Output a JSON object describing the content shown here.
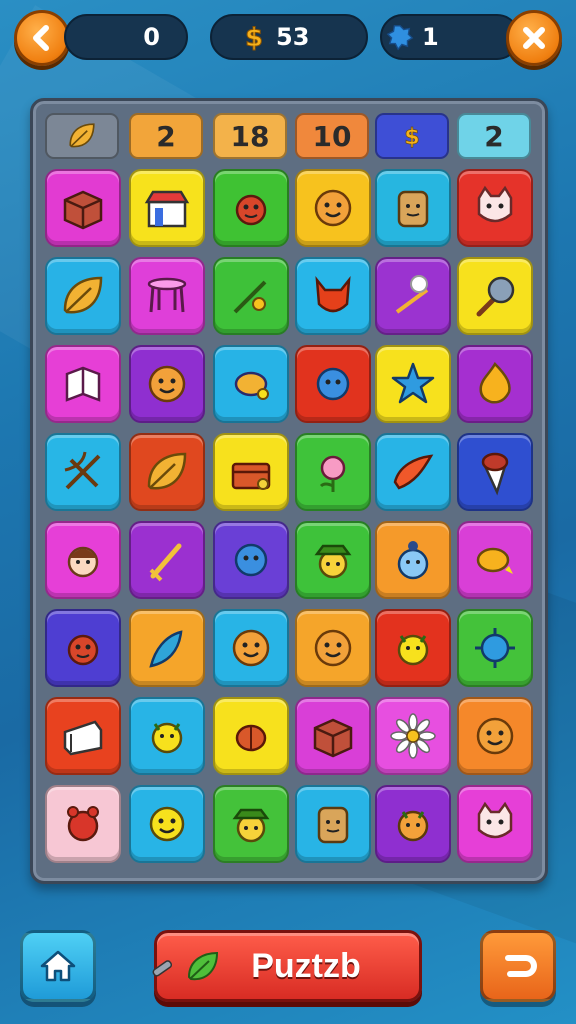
{
  "top_bar": {
    "back_icon": "chevron-left-icon",
    "left_counter": "0",
    "coins": "53",
    "gems": "1",
    "close_icon": "close-icon"
  },
  "header_row": [
    {
      "label": "",
      "icon": "leaf-icon",
      "color": "#7c8796"
    },
    {
      "label": "2",
      "color": "#f2a53a"
    },
    {
      "label": "18",
      "color": "#f3b24a"
    },
    {
      "label": "10",
      "color": "#f0883c"
    },
    {
      "label": "",
      "icon": "dollar-icon",
      "color": "#3e4fd6"
    },
    {
      "label": "2",
      "color": "#6fd3e8"
    }
  ],
  "grid": [
    [
      "box-icon",
      "shop-icon",
      "fish-icon",
      "face-icon",
      "jar-icon",
      "cat-icon"
    ],
    [
      "leaf-icon",
      "table-icon",
      "sprout-icon",
      "devil-icon",
      "wand-icon",
      "brush-icon"
    ],
    [
      "book-icon",
      "face-icon",
      "seed-icon",
      "blob-icon",
      "star-icon",
      "flame-icon"
    ],
    [
      "bow-icon",
      "leaf-icon",
      "chest-icon",
      "flower-icon",
      "wing-icon",
      "cone-icon"
    ],
    [
      "boy-icon",
      "sword-icon",
      "blob-icon",
      "farmer-icon",
      "snowman-icon",
      "lemon-icon"
    ],
    [
      "fish-icon",
      "feather-icon",
      "face-icon",
      "face-icon",
      "bird-icon",
      "virus-icon"
    ],
    [
      "cake-icon",
      "bird-icon",
      "turkey-icon",
      "box-icon",
      "daisy-icon",
      "face-icon"
    ],
    [
      "bear-icon",
      "smiley-icon",
      "farmer-icon",
      "jar-icon",
      "bug-icon",
      "cat-icon"
    ]
  ],
  "grid_colors": [
    [
      "#e23bd2",
      "#f7e21c",
      "#3fc233",
      "#f7c21e",
      "#27b6e0",
      "#e5332a"
    ],
    [
      "#28b2e6",
      "#df3fd9",
      "#3ec139",
      "#28b6e8",
      "#9b33d0",
      "#f7e11d"
    ],
    [
      "#e63fd6",
      "#8f2fd0",
      "#27b3e6",
      "#e1331e",
      "#f7e11d",
      "#a52fd0"
    ],
    [
      "#28b6e6",
      "#e0481f",
      "#f7e11d",
      "#3fc33a",
      "#28b4e6",
      "#2f4fd0"
    ],
    [
      "#e63fd7",
      "#9b30d0",
      "#6a3fd6",
      "#3ec23a",
      "#f59a2a",
      "#d93fd7"
    ],
    [
      "#4e3ed2",
      "#f5a52a",
      "#28b4e6",
      "#f5a52a",
      "#e3321e",
      "#44c23a"
    ],
    [
      "#e8421f",
      "#28b4e6",
      "#f7e11d",
      "#d93fd7",
      "#e74fe0",
      "#f5882a"
    ],
    [
      "#f7c7d4",
      "#28b4e6",
      "#44c23a",
      "#28b4e6",
      "#8f2fd0",
      "#e63fd7"
    ]
  ],
  "bottom_bar": {
    "home_icon": "home-icon",
    "puzzle_label": "Puztzb",
    "undo_icon": "undo-icon"
  }
}
